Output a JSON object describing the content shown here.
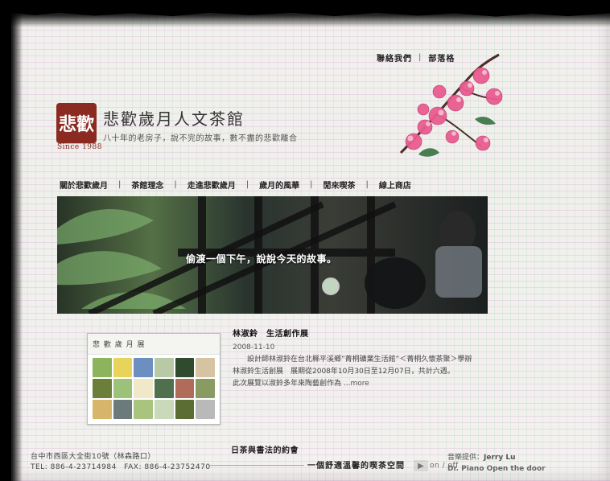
{
  "header": {
    "top_links": [
      {
        "label": "聯絡我們"
      },
      {
        "label": "部落格"
      }
    ],
    "site_title": "悲歡歲月人文茶館",
    "tagline": "八十年的老房子，說不完的故事，數不盡的悲歡離合",
    "logo_text": "悲歡",
    "since": "Since 1988"
  },
  "nav": {
    "items": [
      {
        "label": "關於悲歡歲月"
      },
      {
        "label": "茶館理念"
      },
      {
        "label": "走進悲歡歲月"
      },
      {
        "label": "歲月的風華"
      },
      {
        "label": "閒來喫茶"
      },
      {
        "label": "線上商店"
      }
    ]
  },
  "hero": {
    "caption": "偷渡一個下午，說說今天的故事。"
  },
  "news": {
    "thumb_top_text": "悲 歡 歲 月 展",
    "title": "林淑鈴　生活創作展",
    "date": "2008-11-10",
    "body_line1": "設計師林淑鈴在台北縣平溪鄉”菁桐礦業生活館”＜菁桐久懷茶聚＞學辦",
    "body_line2": "林淑鈴生活創展　展期從2008年10月30日至12月07日，共計六週。",
    "body_line3": "此次展覽以淑鈴多年來陶藝創作為",
    "more_label": "...more"
  },
  "partial_section_title": "日茶與書法的約會",
  "footer": {
    "address_line1": "台中市西區大全街10號（林森路口）",
    "address_line2": "TEL: 886-4-23714984　FAX: 886-4-23752470",
    "slogan": "一個舒適溫馨的喫茶空間",
    "music_label": "音樂提供：",
    "music_credit": "Jerry Lu",
    "music_subline": "Dr. Piano Open the door",
    "onoff": "on / off"
  },
  "colors": {
    "paper": "#f2f0ee",
    "brand_red": "#8a2a21",
    "text": "#333333"
  },
  "icons": {
    "play": "play-icon"
  }
}
